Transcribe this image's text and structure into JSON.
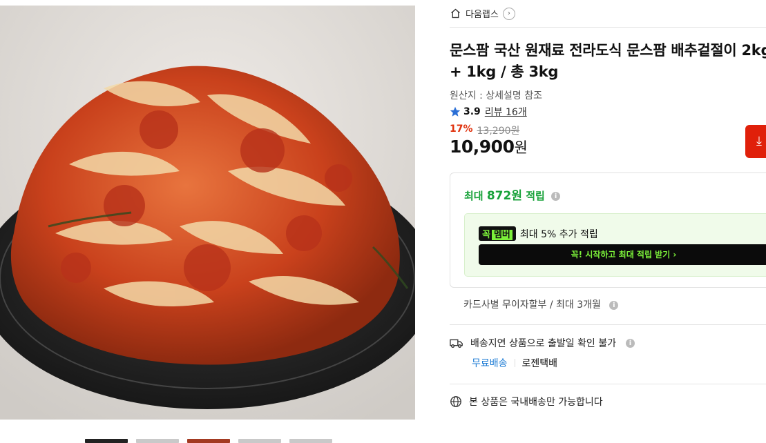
{
  "store": {
    "name": "다움랩스",
    "chevron": "›"
  },
  "product": {
    "title_line1": "문스팜 국산 원재료 전라도식 문스팜 배추겉절이 2kg",
    "title_line2": "+ 1kg / 총 3kg",
    "origin": "원산지 : 상세설명 참조",
    "rating": "3.9",
    "review_link": "리뷰 16개",
    "discount_pct": "17%",
    "original_price": "13,290원",
    "price": "10,900",
    "price_unit": "원"
  },
  "reward": {
    "prefix": "최대",
    "amount": "872원",
    "suffix": "적립",
    "member_badge": "꼭",
    "member_badge_word": "멤버",
    "member_text": "최대 5% 추가 적립",
    "join_button": "꼭! 시작하고 최대 적립 받기  ›"
  },
  "installment": "카드사별 무이자할부 / 최대 3개월",
  "shipping": {
    "notice": "배송지연 상품으로 출발일 확인 불가",
    "free": "무료배송",
    "carrier": "로젠택배",
    "domestic": "본 상품은 국내배송만 가능합니다"
  },
  "colors": {
    "accent_red": "#e0300b",
    "reward_green": "#18a23a",
    "link_blue": "#1a7ad4",
    "member_lime": "#7cf13a"
  },
  "icons": [
    "home-icon",
    "star-icon",
    "info-icon",
    "truck-icon",
    "globe-icon",
    "download-icon"
  ]
}
